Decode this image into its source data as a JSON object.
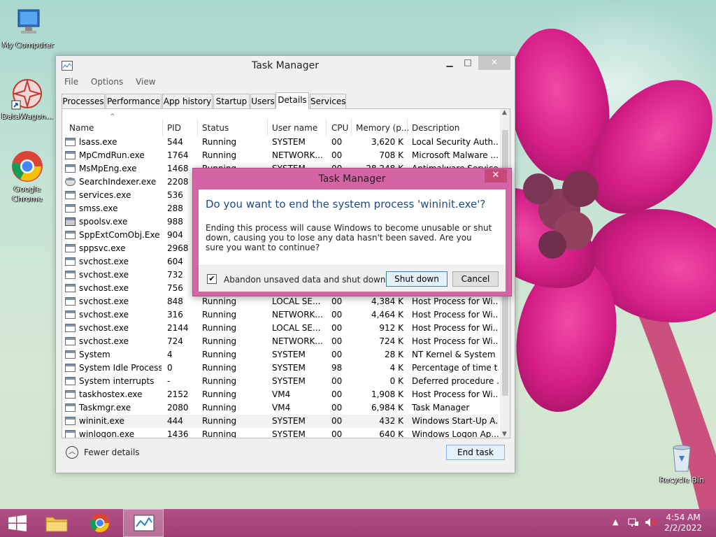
{
  "desktop": {
    "icons": [
      {
        "label": "My Computer"
      },
      {
        "label": "DataWagon..."
      },
      {
        "label": "Google Chrome"
      },
      {
        "label": "Recycle Bin"
      }
    ]
  },
  "task_manager": {
    "title": "Task Manager",
    "menu": [
      "File",
      "Options",
      "View"
    ],
    "tabs": [
      "Processes",
      "Performance",
      "App history",
      "Startup",
      "Users",
      "Details",
      "Services"
    ],
    "active_tab": "Details",
    "columns": [
      "Name",
      "PID",
      "Status",
      "User name",
      "CPU",
      "Memory (p...",
      "Description"
    ],
    "rows": [
      {
        "name": "lsass.exe",
        "pid": "544",
        "status": "Running",
        "user": "SYSTEM",
        "cpu": "00",
        "mem": "3,620 K",
        "desc": "Local Security Auth..."
      },
      {
        "name": "MpCmdRun.exe",
        "pid": "1764",
        "status": "Running",
        "user": "NETWORK...",
        "cpu": "00",
        "mem": "708 K",
        "desc": "Microsoft Malware ..."
      },
      {
        "name": "MsMpEng.exe",
        "pid": "1468",
        "status": "Running",
        "user": "SYSTEM",
        "cpu": "00",
        "mem": "28,248 K",
        "desc": "Antimalware Service..."
      },
      {
        "name": "SearchIndexer.exe",
        "pid": "2208",
        "status": "",
        "user": "",
        "cpu": "",
        "mem": "",
        "desc": ""
      },
      {
        "name": "services.exe",
        "pid": "536",
        "status": "",
        "user": "",
        "cpu": "",
        "mem": "",
        "desc": ""
      },
      {
        "name": "smss.exe",
        "pid": "288",
        "status": "",
        "user": "",
        "cpu": "",
        "mem": "",
        "desc": ""
      },
      {
        "name": "spoolsv.exe",
        "pid": "988",
        "status": "",
        "user": "",
        "cpu": "",
        "mem": "",
        "desc": ""
      },
      {
        "name": "SppExtComObj.Exe",
        "pid": "904",
        "status": "",
        "user": "",
        "cpu": "",
        "mem": "",
        "desc": ""
      },
      {
        "name": "sppsvc.exe",
        "pid": "2968",
        "status": "",
        "user": "",
        "cpu": "",
        "mem": "",
        "desc": ""
      },
      {
        "name": "svchost.exe",
        "pid": "604",
        "status": "",
        "user": "",
        "cpu": "",
        "mem": "",
        "desc": ""
      },
      {
        "name": "svchost.exe",
        "pid": "732",
        "status": "",
        "user": "",
        "cpu": "",
        "mem": "",
        "desc": ""
      },
      {
        "name": "svchost.exe",
        "pid": "756",
        "status": "",
        "user": "",
        "cpu": "",
        "mem": "",
        "desc": ""
      },
      {
        "name": "svchost.exe",
        "pid": "848",
        "status": "Running",
        "user": "LOCAL SE...",
        "cpu": "00",
        "mem": "4,384 K",
        "desc": "Host Process for Wi..."
      },
      {
        "name": "svchost.exe",
        "pid": "316",
        "status": "Running",
        "user": "NETWORK...",
        "cpu": "00",
        "mem": "4,464 K",
        "desc": "Host Process for Wi..."
      },
      {
        "name": "svchost.exe",
        "pid": "2144",
        "status": "Running",
        "user": "LOCAL SE...",
        "cpu": "00",
        "mem": "912 K",
        "desc": "Host Process for Wi..."
      },
      {
        "name": "svchost.exe",
        "pid": "724",
        "status": "Running",
        "user": "NETWORK...",
        "cpu": "00",
        "mem": "724 K",
        "desc": "Host Process for Wi..."
      },
      {
        "name": "System",
        "pid": "4",
        "status": "Running",
        "user": "SYSTEM",
        "cpu": "00",
        "mem": "28 K",
        "desc": "NT Kernel & System"
      },
      {
        "name": "System Idle Process",
        "pid": "0",
        "status": "Running",
        "user": "SYSTEM",
        "cpu": "98",
        "mem": "4 K",
        "desc": "Percentage of time t..."
      },
      {
        "name": "System interrupts",
        "pid": "-",
        "status": "Running",
        "user": "SYSTEM",
        "cpu": "00",
        "mem": "0 K",
        "desc": "Deferred procedure ..."
      },
      {
        "name": "taskhostex.exe",
        "pid": "2152",
        "status": "Running",
        "user": "VM4",
        "cpu": "00",
        "mem": "1,908 K",
        "desc": "Host Process for Wi..."
      },
      {
        "name": "Taskmgr.exe",
        "pid": "2080",
        "status": "Running",
        "user": "VM4",
        "cpu": "00",
        "mem": "6,984 K",
        "desc": "Task Manager"
      },
      {
        "name": "wininit.exe",
        "pid": "444",
        "status": "Running",
        "user": "SYSTEM",
        "cpu": "00",
        "mem": "432 K",
        "desc": "Windows Start-Up A..."
      },
      {
        "name": "winlogon.exe",
        "pid": "1436",
        "status": "Running",
        "user": "SYSTEM",
        "cpu": "00",
        "mem": "640 K",
        "desc": "Windows Logon Ap..."
      }
    ],
    "selected_row": "wininit.exe",
    "fewer_details": "Fewer details",
    "end_task": "End task"
  },
  "dialog": {
    "title": "Task Manager",
    "close": "✕",
    "heading": "Do you want to end the system process 'wininit.exe'?",
    "message": "Ending this process will cause Windows to become unusable or shut down, causing you to lose any data hasn't been saved. Are you sure you want to continue?",
    "checkbox_label": "Abandon unsaved data and shut down.",
    "checkbox_checked": true,
    "check_mark": "✔",
    "shutdown_button": "Shut down",
    "cancel_button": "Cancel"
  },
  "taskbar": {
    "time": "4:54 AM",
    "date": "2/2/2022"
  },
  "colors": {
    "dialog_frame": "#d564a5",
    "taskbar": "#a8467c",
    "heading_blue": "#1a4a8a"
  }
}
